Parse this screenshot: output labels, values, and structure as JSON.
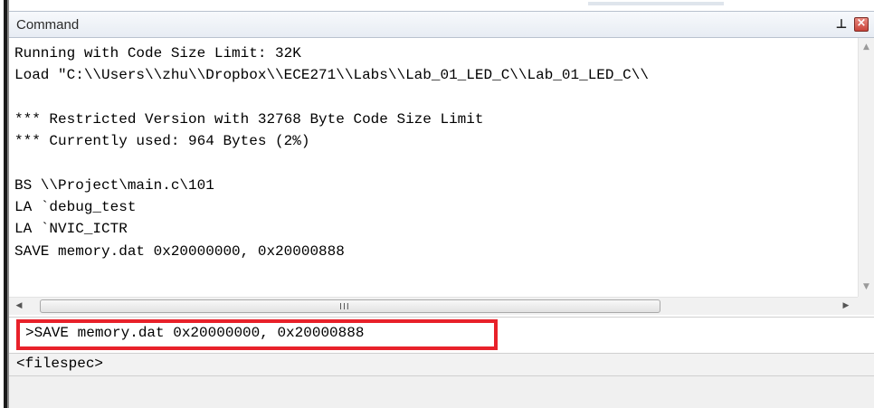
{
  "window": {
    "title": "Command",
    "pin_icon": "pin-icon",
    "close_icon": "close-icon"
  },
  "output": {
    "lines": [
      "Running with Code Size Limit: 32K",
      "Load \"C:\\\\Users\\\\zhu\\\\Dropbox\\\\ECE271\\\\Labs\\\\Lab_01_LED_C\\\\Lab_01_LED_C\\\\",
      "",
      "*** Restricted Version with 32768 Byte Code Size Limit",
      "*** Currently used: 964 Bytes (2%)",
      "",
      "BS \\\\Project\\main.c\\101",
      "LA `debug_test",
      "LA `NVIC_ICTR",
      "SAVE memory.dat 0x20000000, 0x20000888"
    ]
  },
  "scrollbars": {
    "hscroll_grip": "III"
  },
  "command_input": {
    "value": ">SAVE memory.dat 0x20000000, 0x20000888",
    "highlight_color": "#e8212a"
  },
  "hint": {
    "text": "<filespec>"
  }
}
